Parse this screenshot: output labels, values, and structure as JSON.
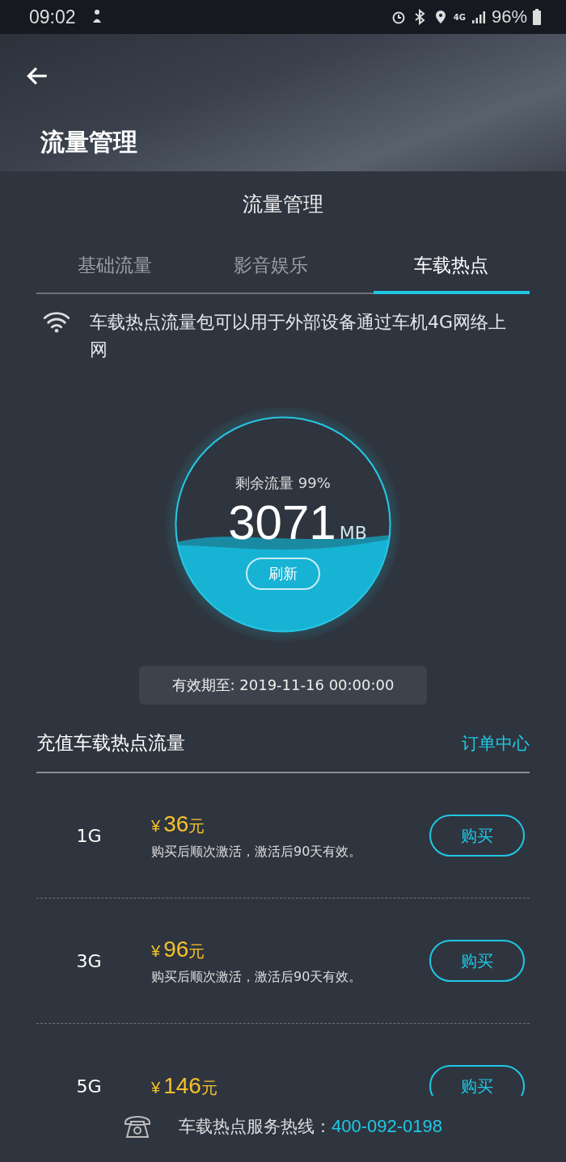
{
  "status_bar": {
    "time": "09:02",
    "network": "4G",
    "battery": "96%"
  },
  "header": {
    "title": "流量管理"
  },
  "panel_title": "流量管理",
  "tabs": [
    {
      "label": "基础流量",
      "selected": false
    },
    {
      "label": "影音娱乐",
      "selected": false
    },
    {
      "label": "车载热点",
      "selected": true
    }
  ],
  "notice": "车载热点流量包可以用于外部设备通过车机4G网络上网",
  "gauge": {
    "label": "剩余流量",
    "percent": "99%",
    "amount": "3071",
    "unit": "MB",
    "refresh": "刷新"
  },
  "expiry": "有效期至: 2019-11-16 00:00:00",
  "section": {
    "title": "充值车载热点流量",
    "link": "订单中心"
  },
  "plans": [
    {
      "size": "1G",
      "price_symbol": "¥",
      "price": "36",
      "price_unit": "元",
      "note": "购买后顺次激活，激活后90天有效。",
      "button": "购买"
    },
    {
      "size": "3G",
      "price_symbol": "¥",
      "price": "96",
      "price_unit": "元",
      "note": "购买后顺次激活，激活后90天有效。",
      "button": "购买"
    },
    {
      "size": "5G",
      "price_symbol": "¥",
      "price": "146",
      "price_unit": "元",
      "button": "购买"
    }
  ],
  "footer": {
    "label": "车载热点服务热线：",
    "phone": "400-092-0198"
  }
}
